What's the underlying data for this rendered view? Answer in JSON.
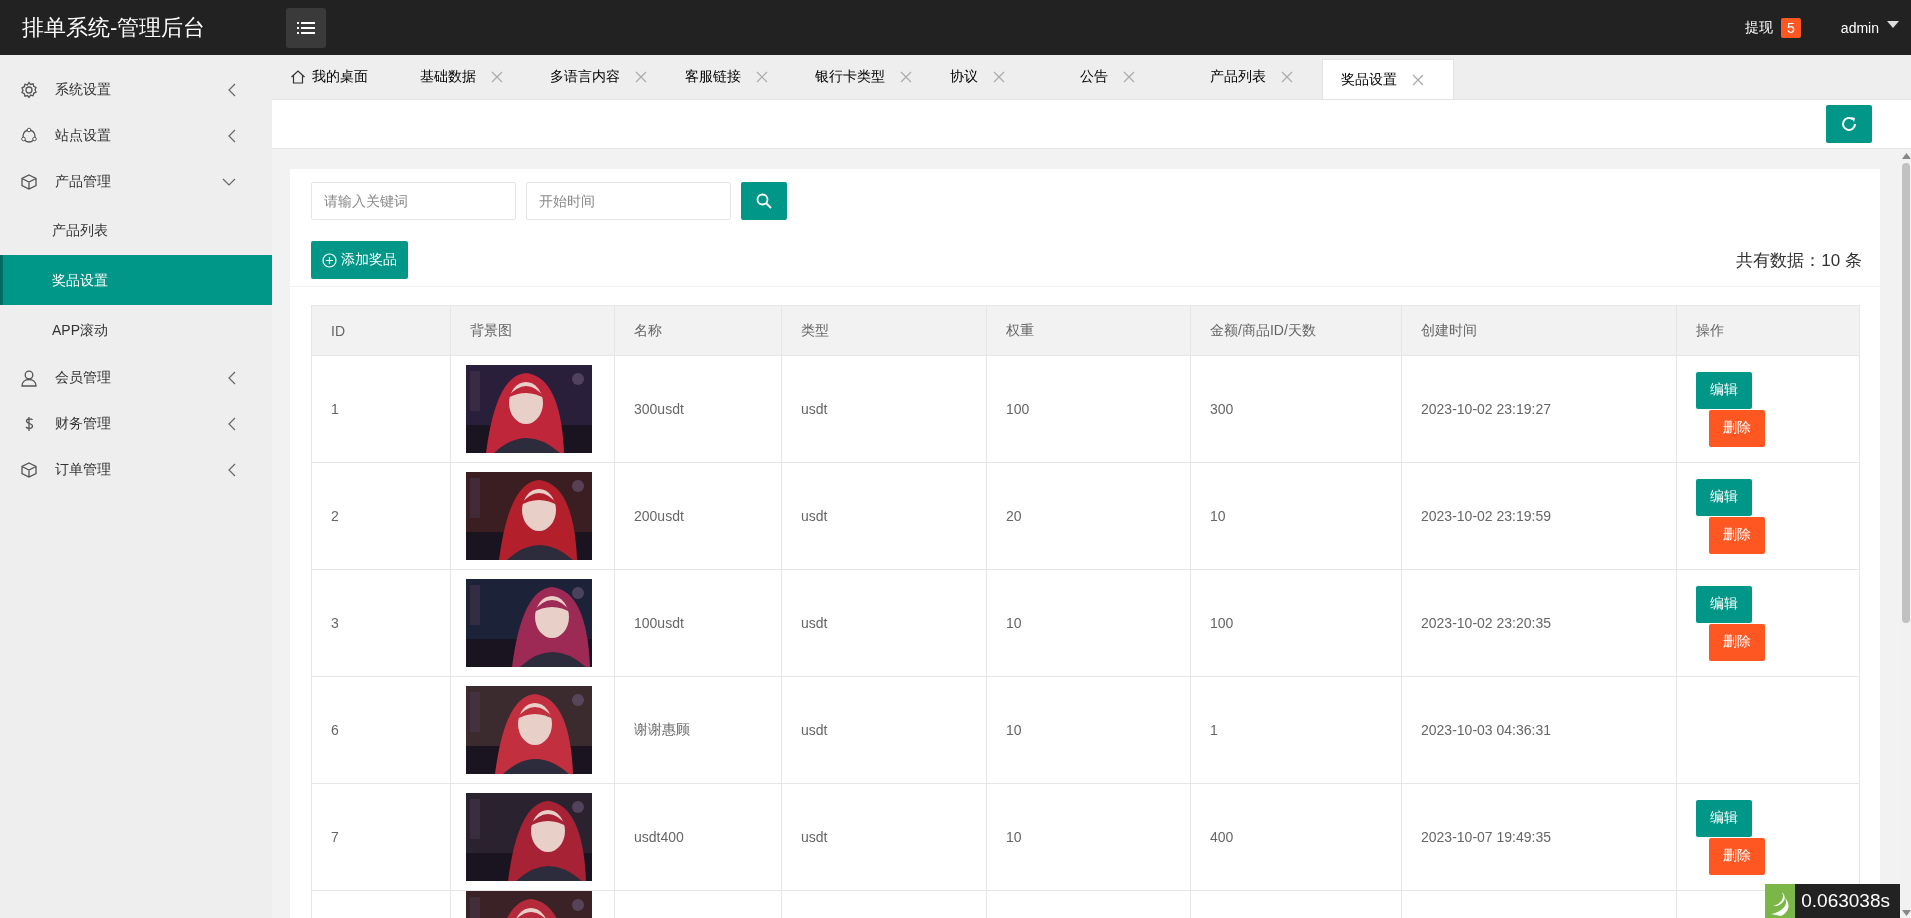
{
  "header": {
    "title": "排单系统-管理后台",
    "withdraw": {
      "label": "提现",
      "count": "5"
    },
    "user": "admin"
  },
  "sidebar": {
    "items": [
      {
        "label": "系统设置",
        "expanded": false
      },
      {
        "label": "站点设置",
        "expanded": false
      },
      {
        "label": "产品管理",
        "expanded": true,
        "children": [
          {
            "label": "产品列表",
            "selected": false
          },
          {
            "label": "奖品设置",
            "selected": true
          },
          {
            "label": "APP滚动",
            "selected": false
          }
        ]
      },
      {
        "label": "会员管理",
        "expanded": false
      },
      {
        "label": "财务管理",
        "expanded": false
      },
      {
        "label": "订单管理",
        "expanded": false
      }
    ]
  },
  "tabs": [
    {
      "label": "我的桌面",
      "kind": "home",
      "selected": false
    },
    {
      "label": "基础数据",
      "kind": "closable",
      "selected": false
    },
    {
      "label": "多语言内容",
      "kind": "closable",
      "selected": false
    },
    {
      "label": "客服链接",
      "kind": "closable",
      "selected": false
    },
    {
      "label": "银行卡类型",
      "kind": "closable",
      "selected": false
    },
    {
      "label": "协议",
      "kind": "closable",
      "selected": false
    },
    {
      "label": "公告",
      "kind": "closable",
      "selected": false
    },
    {
      "label": "产品列表",
      "kind": "closable",
      "selected": false
    },
    {
      "label": "奖品设置",
      "kind": "closable",
      "selected": true
    }
  ],
  "search": {
    "keyword": {
      "placeholder": "请输入关键词"
    },
    "start_time": {
      "placeholder": "开始时间"
    }
  },
  "add_button": "添加奖品",
  "total": "共有数据：10 条",
  "table": {
    "columns": [
      "ID",
      "背景图",
      "名称",
      "类型",
      "权重",
      "金额/商品ID/天数",
      "创建时间",
      "操作"
    ],
    "rows": [
      {
        "kind": "full",
        "id": "1",
        "image": {
          "kind": "picture"
        },
        "name": "300usdt",
        "type": "usdt",
        "weight": "100",
        "amount": "300",
        "created": "2023-10-02 23:19:27",
        "actions": [
          {
            "label": "编辑",
            "kind": "edit"
          },
          {
            "label": "删除",
            "kind": "delete"
          }
        ]
      },
      {
        "kind": "full",
        "id": "2",
        "image": {
          "kind": "picture"
        },
        "name": "200usdt",
        "type": "usdt",
        "weight": "20",
        "amount": "10",
        "created": "2023-10-02 23:19:59",
        "actions": [
          {
            "label": "编辑",
            "kind": "edit"
          },
          {
            "label": "删除",
            "kind": "delete"
          }
        ]
      },
      {
        "kind": "full",
        "id": "3",
        "image": {
          "kind": "picture"
        },
        "name": "100usdt",
        "type": "usdt",
        "weight": "10",
        "amount": "100",
        "created": "2023-10-02 23:20:35",
        "actions": [
          {
            "label": "编辑",
            "kind": "edit"
          },
          {
            "label": "删除",
            "kind": "delete"
          }
        ]
      },
      {
        "kind": "full",
        "id": "6",
        "image": {
          "kind": "picture"
        },
        "name": "谢谢惠顾",
        "type": "usdt",
        "weight": "10",
        "amount": "1",
        "created": "2023-10-03 04:36:31"
      },
      {
        "kind": "full",
        "id": "7",
        "image": {
          "kind": "picture"
        },
        "name": "usdt400",
        "type": "usdt",
        "weight": "10",
        "amount": "400",
        "created": "2023-10-07 19:49:35",
        "actions": [
          {
            "label": "编辑",
            "kind": "edit"
          },
          {
            "label": "删除",
            "kind": "delete"
          }
        ]
      },
      {
        "kind": "partial",
        "image": {
          "kind": "picture"
        }
      }
    ]
  },
  "timer": "0.063038s"
}
